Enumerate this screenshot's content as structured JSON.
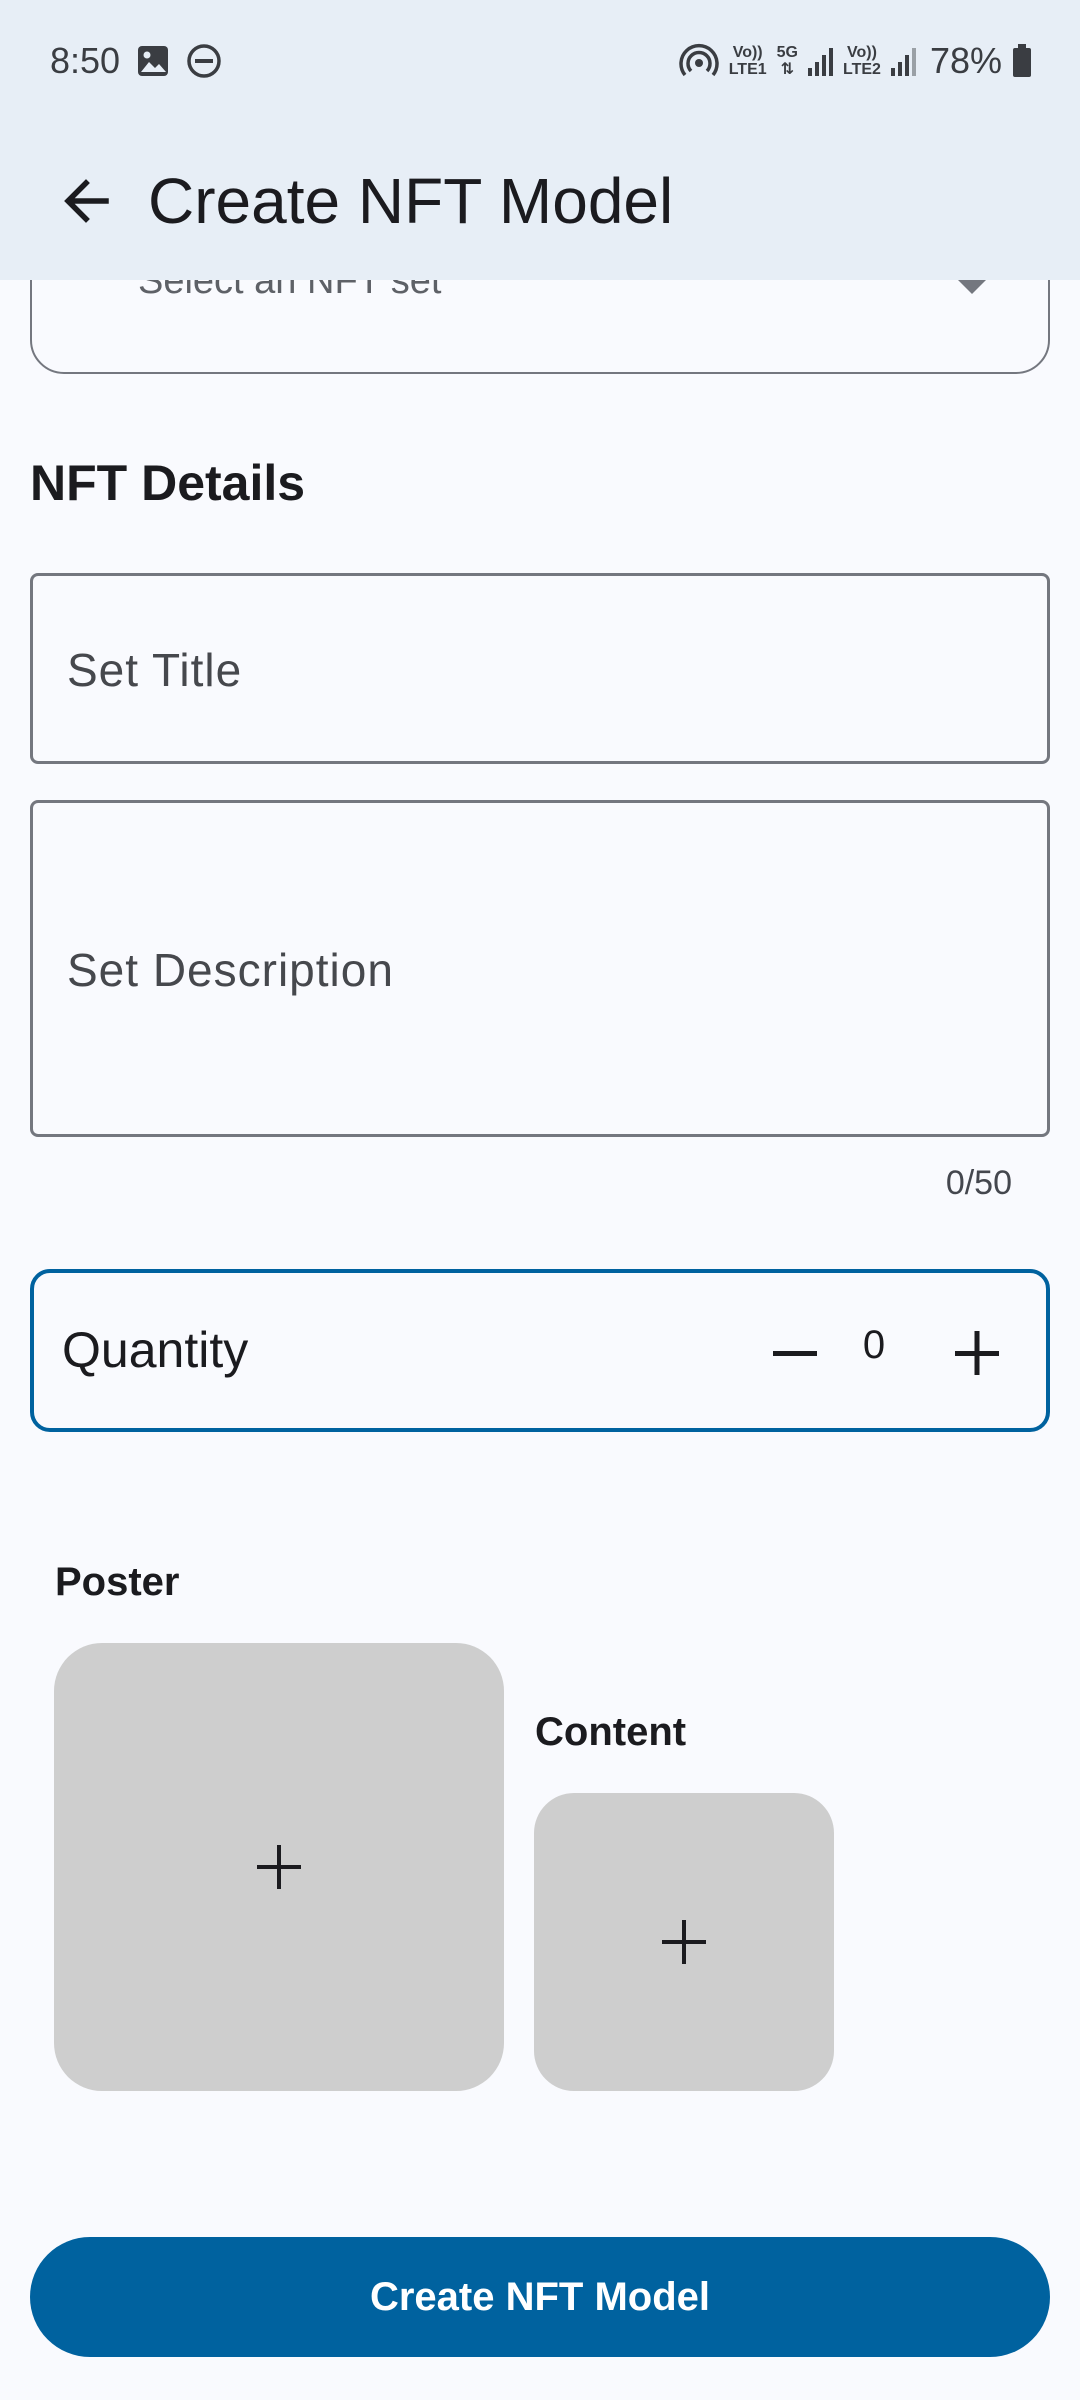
{
  "status_bar": {
    "time": "8:50",
    "left_icons": [
      "image-icon",
      "do-not-disturb-icon"
    ],
    "net1_top": "Vo))",
    "net1_bottom": "LTE1",
    "net_5g": "5G",
    "net2_top": "Vo))",
    "net2_bottom": "LTE2",
    "battery": "78%"
  },
  "app_bar": {
    "title": "Create NFT Model",
    "back_icon": "arrow-back-icon"
  },
  "set_select": {
    "placeholder": "Select an NFT set"
  },
  "nft_details": {
    "heading": "NFT Details",
    "title_placeholder": "Set Title",
    "description_placeholder": "Set Description",
    "char_counter": "0/50"
  },
  "quantity": {
    "label": "Quantity",
    "value": "0"
  },
  "media": {
    "poster_label": "Poster",
    "content_label": "Content"
  },
  "actions": {
    "create_label": "Create NFT Model"
  },
  "colors": {
    "primary": "#00629f",
    "app_bar_bg": "#e7eef6",
    "page_bg": "#f9fafe",
    "tile_bg": "#cecece"
  }
}
